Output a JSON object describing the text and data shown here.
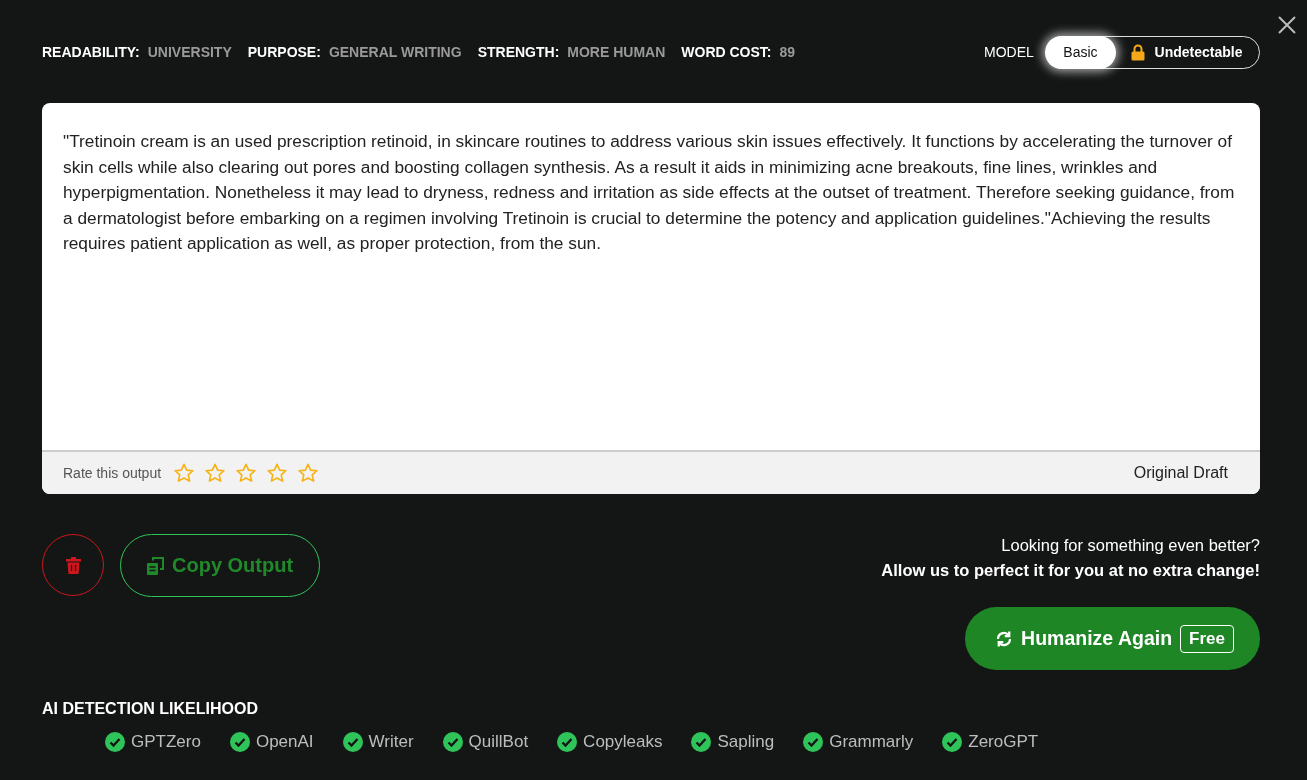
{
  "settings": [
    {
      "label": "READABILITY:",
      "value": "UNIVERSITY"
    },
    {
      "label": "PURPOSE:",
      "value": "GENERAL WRITING"
    },
    {
      "label": "STRENGTH:",
      "value": "MORE HUMAN"
    },
    {
      "label": "WORD COST:",
      "value": "89"
    }
  ],
  "model": {
    "label": "MODEL",
    "options": [
      {
        "label": "Basic",
        "selected": true,
        "locked": false
      },
      {
        "label": "Undetectable",
        "selected": false,
        "locked": true
      }
    ]
  },
  "output": {
    "text": "\"Tretinoin cream is an used prescription retinoid, in skincare routines to address various skin issues effectively. It functions by accelerating the turnover of skin cells while also clearing out pores and boosting collagen synthesis. As a result it aids in minimizing acne breakouts, fine lines, wrinkles and hyperpigmentation. Nonetheless it may lead to dryness, redness and irritation as side effects at the outset of treatment. Therefore seeking guidance, from a dermatologist before embarking on a regimen involving Tretinoin is crucial to determine the potency and application guidelines.\"Achieving the results requires patient application as well, as proper protection, from the sun.",
    "rate_label": "Rate this output",
    "stars": 0,
    "draft_label": "Original Draft"
  },
  "copy_button": "Copy Output",
  "upsell": {
    "line1": "Looking for something even better?",
    "line2": "Allow us to perfect it for you at no extra change!",
    "button": "Humanize Again",
    "badge": "Free"
  },
  "detection": {
    "title": "AI DETECTION LIKELIHOOD",
    "detectors": [
      {
        "name": "GPTZero",
        "passed": true
      },
      {
        "name": "OpenAI",
        "passed": true
      },
      {
        "name": "Writer",
        "passed": true
      },
      {
        "name": "QuillBot",
        "passed": true
      },
      {
        "name": "Copyleaks",
        "passed": true
      },
      {
        "name": "Sapling",
        "passed": true
      },
      {
        "name": "Grammarly",
        "passed": true
      },
      {
        "name": "ZeroGPT",
        "passed": true
      }
    ]
  }
}
